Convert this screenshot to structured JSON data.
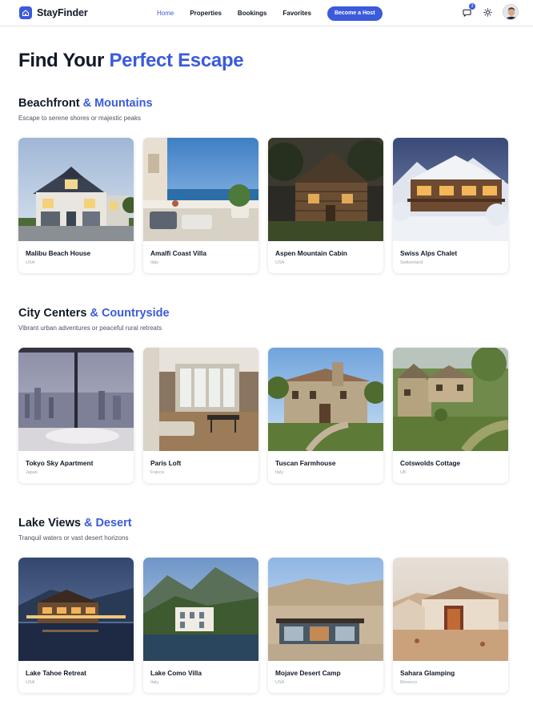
{
  "app": {
    "name": "StayFinder"
  },
  "nav": {
    "links": [
      "Home",
      "Properties",
      "Bookings",
      "Favorites"
    ],
    "active": "Home",
    "host_button": "Become a Host",
    "notification_count": "3"
  },
  "page": {
    "title_plain": "Find Your ",
    "title_accent": "Perfect Escape"
  },
  "colors": {
    "accent": "#3b5bdb"
  },
  "sections": [
    {
      "title_plain": "Beachfront ",
      "title_accent": "& Mountains",
      "subtitle": "Escape to serene shores or majestic peaks",
      "cards": [
        {
          "name": "Malibu Beach House",
          "location": "USA"
        },
        {
          "name": "Amalfi Coast Villa",
          "location": "Italy"
        },
        {
          "name": "Aspen Mountain Cabin",
          "location": "USA"
        },
        {
          "name": "Swiss Alps Chalet",
          "location": "Switzerland"
        }
      ]
    },
    {
      "title_plain": "City Centers ",
      "title_accent": "& Countryside",
      "subtitle": "Vibrant urban adventures or peaceful rural retreats",
      "cards": [
        {
          "name": "Tokyo Sky Apartment",
          "location": "Japan"
        },
        {
          "name": "Paris Loft",
          "location": "France"
        },
        {
          "name": "Tuscan Farmhouse",
          "location": "Italy"
        },
        {
          "name": "Cotswolds Cottage",
          "location": "UK"
        }
      ]
    },
    {
      "title_plain": "Lake Views ",
      "title_accent": "& Desert",
      "subtitle": "Tranquil waters or vast desert horizons",
      "cards": [
        {
          "name": "Lake Tahoe Retreat",
          "location": "USA"
        },
        {
          "name": "Lake Como Villa",
          "location": "Italy"
        },
        {
          "name": "Mojave Desert Camp",
          "location": "USA"
        },
        {
          "name": "Sahara Glamping",
          "location": "Morocco"
        }
      ]
    }
  ]
}
